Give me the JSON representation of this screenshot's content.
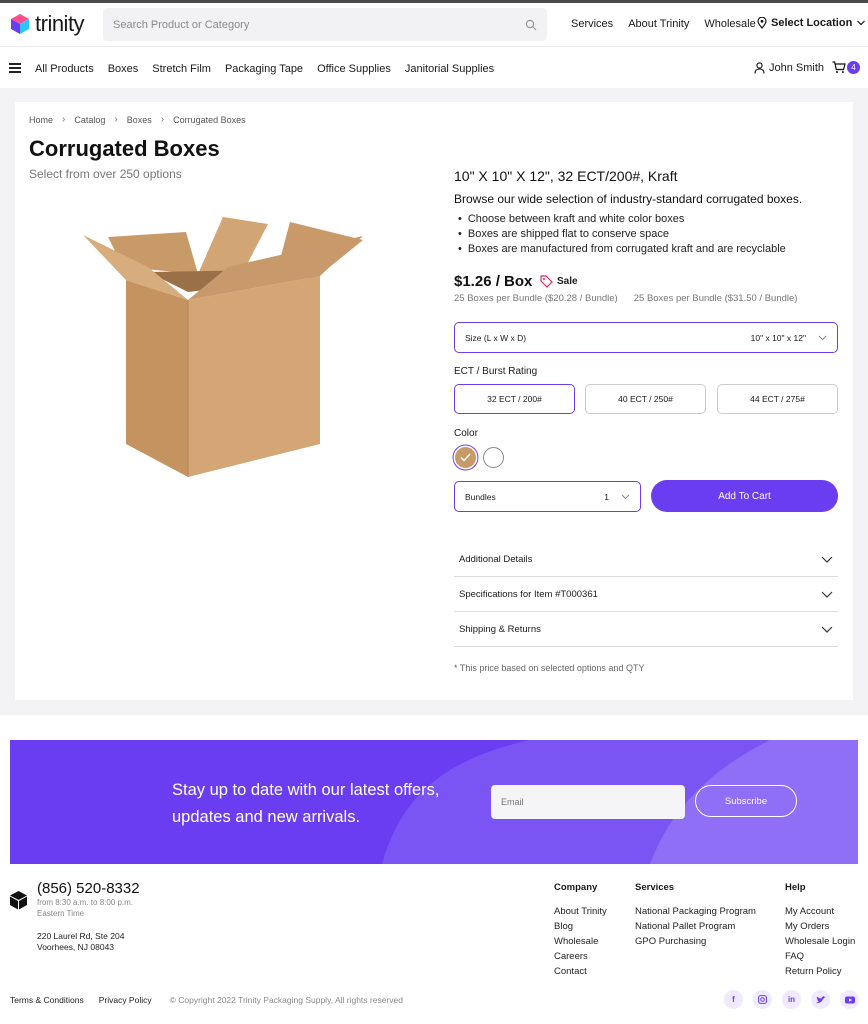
{
  "header": {
    "logo_text": "trinity",
    "search_placeholder": "Search Product or Category",
    "links": [
      "Services",
      "About Trinity",
      "Wholesale"
    ],
    "location_label": "Select Location",
    "nav": [
      "All Products",
      "Boxes",
      "Stretch Film",
      "Packaging Tape",
      "Office Supplies",
      "Janitorial Supplies"
    ],
    "user_name": "John Smith",
    "cart_count": "4"
  },
  "breadcrumb": [
    "Home",
    "Catalog",
    "Boxes",
    "Corrugated Boxes"
  ],
  "page": {
    "title": "Corrugated Boxes",
    "subtitle": "Select from over 250 options"
  },
  "product": {
    "name": "10\" X 10\" X 12\", 32 ECT/200#, Kraft",
    "lead": "Browse our wide selection of industry-standard corrugated boxes.",
    "bullets": [
      "Choose between kraft and white color boxes",
      "Boxes are shipped flat to conserve space",
      "Boxes are manufactured from corrugated kraft and are recyclable"
    ],
    "price": "$1.26 / Box",
    "sale_label": "Sale",
    "bundle_price_1": "25 Boxes per Bundle ($20.28 / Bundle)",
    "bundle_price_2": "25 Boxes per Bundle ($31.50 / Bundle)",
    "size_label": "Size (L x W x D)",
    "size_value": "10\" x 10\" x 12\"",
    "ect_label": "ECT / Burst Rating",
    "ect_options": [
      "32 ECT / 200#",
      "40 ECT / 250#",
      "44 ECT / 275#"
    ],
    "ect_selected": 0,
    "color_label": "Color",
    "colors": [
      "kraft",
      "white"
    ],
    "color_selected": "kraft",
    "qty_label": "Bundles",
    "qty_value": "1",
    "add_to_cart": "Add To Cart",
    "accordion": [
      "Additional Details",
      "Specifications for Item #T000361",
      "Shipping & Returns"
    ],
    "note": "* This price based on selected options and QTY"
  },
  "newsletter": {
    "line1": "Stay up to date with our latest offers,",
    "line2": "updates and new arrivals.",
    "email_placeholder": "Email",
    "subscribe_label": "Subscribe"
  },
  "footer": {
    "phone": "(856) 520-8332",
    "hours_1": "from 8:30 a.m. to 8:00 p.m.",
    "hours_2": "Eastern Time",
    "address_1": "220 Laurel Rd, Ste 204",
    "address_2": "Voorhees, NJ 08043",
    "company": {
      "heading": "Company",
      "links": [
        "About Trinity",
        "Blog",
        "Wholesale",
        "Careers",
        "Contact"
      ]
    },
    "services": {
      "heading": "Services",
      "links": [
        "National Packaging Program",
        "National Pallet Program",
        "GPO Purchasing"
      ]
    },
    "help": {
      "heading": "Help",
      "links": [
        "My Account",
        "My Orders",
        "Wholesale Login",
        "FAQ",
        "Return Policy"
      ]
    },
    "terms": "Terms & Conditions",
    "privacy": "Privacy Policy",
    "copyright": "© Copyright 2022 Trinity Packaging Supply, All rights reserved",
    "socials": [
      "facebook-icon",
      "instagram-icon",
      "linkedin-icon",
      "twitter-icon",
      "youtube-icon"
    ]
  },
  "colors": {
    "accent": "#6a3df0",
    "kraft": "#c89a6a"
  }
}
